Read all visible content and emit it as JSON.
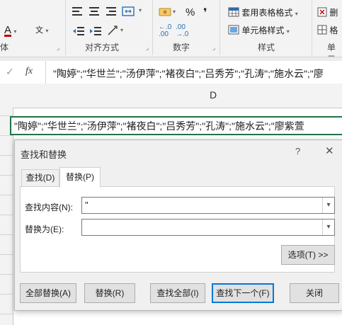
{
  "ribbon": {
    "font_group_label": "体",
    "align_group_label": "对齐方式",
    "number_group_label": "数字",
    "styles_group_label": "样式",
    "cells_group_label": "单元",
    "percent_label": "%",
    "comma_label": "❜",
    "wen_label": "文",
    "font_color_letter": "A",
    "table_format_label": "套用表格格式",
    "cell_style_label": "单元格样式",
    "delete_label": "删",
    "format_label": "格",
    "increase_decimal_label": "←.0\n.00",
    "decrease_decimal_label": ".00\n→.0"
  },
  "formula_bar": {
    "cancel_icon": "✓",
    "fx_label": "fx",
    "content": "\"陶婷\";\"华世兰\";\"汤伊萍\";\"褚夜白\";\"吕秀芳\";\"孔涛\";\"施水云\";\"廖"
  },
  "sheet": {
    "column_d": "D",
    "cell_value": "\"陶婷\";\"华世兰\";\"汤伊萍\";\"褚夜白\";\"吕秀芳\";\"孔涛\";\"施水云\";\"廖紫萱"
  },
  "dialog": {
    "title": "查找和替换",
    "help": "?",
    "close": "✕",
    "tabs": [
      {
        "label": "查找(D)",
        "active": false
      },
      {
        "label": "替换(P)",
        "active": true
      }
    ],
    "find_label": "查找内容(N):",
    "find_value": "\"",
    "replace_label": "替换为(E):",
    "replace_value": "",
    "options_button": "选项(T) >>",
    "buttons": {
      "replace_all": "全部替换(A)",
      "replace": "替换(R)",
      "find_all": "查找全部(I)",
      "find_next": "查找下一个(F)",
      "close": "关闭"
    }
  },
  "colors": {
    "selection_border": "#217346",
    "font_color_bar": "#c00000",
    "focus_border": "#0078d7"
  }
}
